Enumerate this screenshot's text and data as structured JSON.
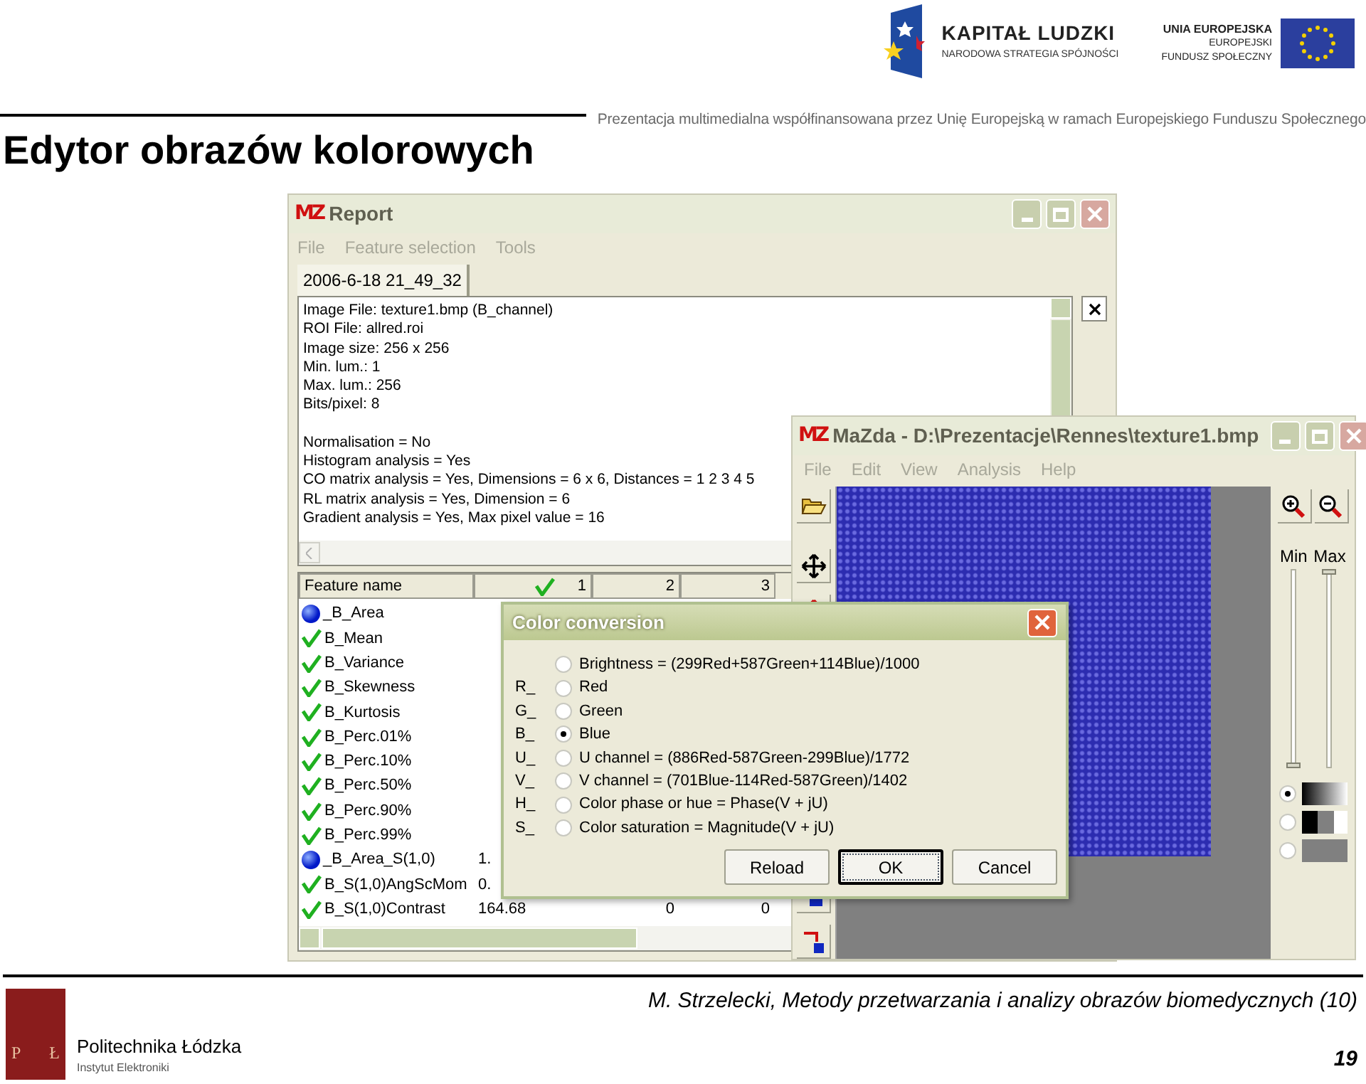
{
  "header": {
    "title": "Edytor obrazów kolorowych",
    "cofinancing_note": "Prezentacja multimedialna współfinansowana przez Unię Europejską w ramach Europejskiego Funduszu Społecznego",
    "logo_left": {
      "name": "KAPITAŁ LUDZKI",
      "subtitle": "NARODOWA STRATEGIA SPÓJNOŚCI"
    },
    "logo_right": {
      "lines": [
        "UNIA EUROPEJSKA",
        "EUROPEJSKI",
        "FUNDUSZ SPOŁECZNY"
      ]
    }
  },
  "report_window": {
    "app_mark": "MZ",
    "title": "Report",
    "menu": [
      "File",
      "Feature selection",
      "Tools"
    ],
    "tabs": [
      {
        "label": "2006-6-18 21_49_32",
        "selected": true
      }
    ],
    "info_lines": [
      "Image File: texture1.bmp (B_channel)",
      "ROI File: allred.roi",
      "Image size: 256 x 256",
      "Min. lum.: 1",
      "Max. lum.: 256",
      "Bits/pixel: 8"
    ],
    "settings_lines": [
      "Normalisation =  No",
      "Histogram analysis = Yes",
      "CO matrix analysis = Yes, Dimensions = 6 x 6, Distances = 1 2 3 4 5",
      "RL matrix analysis = Yes, Dimension = 6",
      "Gradient analysis = Yes, Max pixel value = 16"
    ],
    "table": {
      "columns": [
        "Feature name",
        "1",
        "2",
        "3"
      ],
      "rows": [
        {
          "name": "_B_Area",
          "kind": "dot"
        },
        {
          "name": "B_Mean",
          "kind": "check"
        },
        {
          "name": "B_Variance",
          "kind": "check"
        },
        {
          "name": "B_Skewness",
          "kind": "check"
        },
        {
          "name": "B_Kurtosis",
          "kind": "check"
        },
        {
          "name": "B_Perc.01%",
          "kind": "check"
        },
        {
          "name": "B_Perc.10%",
          "kind": "check"
        },
        {
          "name": "B_Perc.50%",
          "kind": "check"
        },
        {
          "name": "B_Perc.90%",
          "kind": "check"
        },
        {
          "name": "B_Perc.99%",
          "kind": "check"
        },
        {
          "name": "_B_Area_S(1,0)",
          "kind": "dot",
          "values": [
            "1."
          ]
        },
        {
          "name": "B_S(1,0)AngScMom",
          "kind": "check",
          "values": [
            "0."
          ]
        },
        {
          "name": "B_S(1,0)Contrast",
          "kind": "check",
          "values": [
            "164.68",
            "0",
            "0"
          ]
        }
      ]
    }
  },
  "mazda_window": {
    "app_mark": "MZ",
    "title": "MaZda - D:\\Prezentacje\\Rennes\\texture1.bmp",
    "menu": [
      "File",
      "Edit",
      "View",
      "Analysis",
      "Help"
    ],
    "range_sliders": [
      {
        "label": "Min",
        "level": 0
      },
      {
        "label": "Max",
        "level": 1
      }
    ],
    "palettes": [
      {
        "kind": "gradient",
        "selected": true
      },
      {
        "kind": "steps",
        "selected": false
      },
      {
        "kind": "flat",
        "selected": false
      }
    ]
  },
  "color_dialog": {
    "title": "Color conversion",
    "options": [
      {
        "label": "Brightness = (299Red+587Green+114Blue)/1000",
        "selected": false
      },
      {
        "prefix": "R_",
        "label": "Red",
        "selected": false
      },
      {
        "prefix": "G_",
        "label": "Green",
        "selected": false
      },
      {
        "prefix": "B_",
        "label": "Blue",
        "selected": true
      },
      {
        "prefix": "U_",
        "label": "U channel = (886Red-587Green-299Blue)/1772",
        "selected": false
      },
      {
        "prefix": "V_",
        "label": "V channel = (701Blue-114Red-587Green)/1402",
        "selected": false
      },
      {
        "prefix": "H_",
        "label": "Color phase or hue = Phase(V + jU)",
        "selected": false
      },
      {
        "prefix": "S_",
        "label": "Color saturation = Magnitude(V + jU)",
        "selected": false
      }
    ],
    "buttons": [
      {
        "label": "Reload",
        "focused": false
      },
      {
        "label": "OK",
        "focused": true
      },
      {
        "label": "Cancel",
        "focused": false
      }
    ]
  },
  "footer": {
    "citation": "M. Strzelecki, Metody przetwarzania i analizy obrazów biomedycznych (10)",
    "logo_letters": [
      "P",
      "Ł"
    ],
    "institution": "Politechnika Łódzka",
    "department": "Instytut Elektroniki",
    "page_number": "19"
  }
}
